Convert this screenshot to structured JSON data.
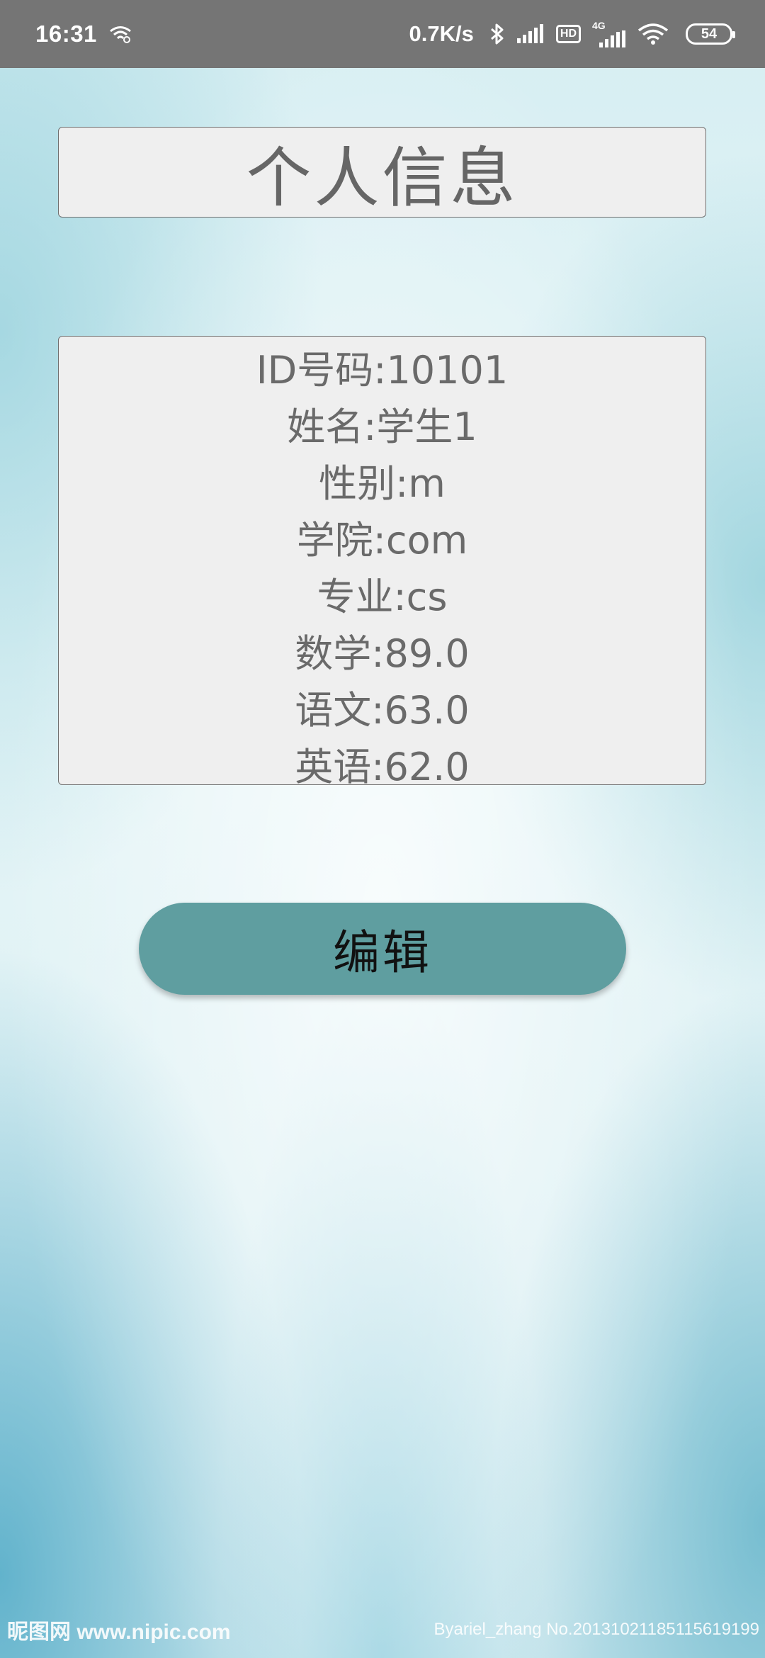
{
  "status_bar": {
    "time": "16:31",
    "net_speed": "0.7K/s",
    "hd_label": "HD",
    "battery_level": "54",
    "network_type": "4G"
  },
  "title": "个人信息",
  "info": {
    "lines": [
      "ID号码:10101",
      "姓名:学生1",
      "性别:m",
      "学院:com",
      "专业:cs",
      "数学:89.0",
      "语文:63.0",
      "英语:62.0"
    ]
  },
  "edit_button": {
    "label": "编辑"
  },
  "watermark": {
    "left": "昵图网 www.nipic.com",
    "right": "Byariel_zhang No.20131021185115619199"
  },
  "colors": {
    "status_bar": "#757575",
    "button": "#5f9ea0",
    "panel": "#efefef",
    "text": "#666666"
  }
}
